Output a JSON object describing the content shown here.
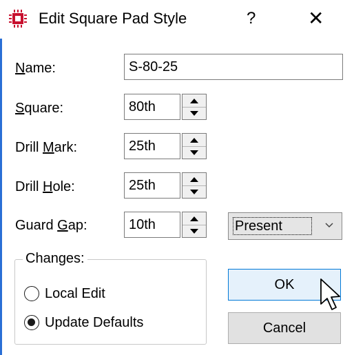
{
  "window": {
    "title": "Edit Square Pad Style",
    "help_label": "?",
    "close_label": "✕",
    "app_icon": "chip-icon"
  },
  "fields": {
    "name": {
      "label_pre": "",
      "label_mn": "N",
      "label_post": "ame:",
      "value": "S-80-25"
    },
    "square": {
      "label_pre": "",
      "label_mn": "S",
      "label_post": "quare:",
      "value": "80th"
    },
    "drill_mark": {
      "label_pre": "Drill ",
      "label_mn": "M",
      "label_post": "ark:",
      "value": "25th"
    },
    "drill_hole": {
      "label_pre": "Drill ",
      "label_mn": "H",
      "label_post": "ole:",
      "value": "25th"
    },
    "guard_gap": {
      "label_pre": "Guard ",
      "label_mn": "G",
      "label_post": "ap:",
      "value": "10th",
      "option": "Present"
    }
  },
  "changes": {
    "title": "Changes:",
    "options": [
      {
        "label": "Local Edit",
        "selected": false
      },
      {
        "label": "Update Defaults",
        "selected": true
      }
    ]
  },
  "buttons": {
    "ok": "OK",
    "cancel": "Cancel"
  },
  "colors": {
    "accent": "#0078d7",
    "icon_red": "#c8102e",
    "ok_bg": "#e5f1fb"
  }
}
